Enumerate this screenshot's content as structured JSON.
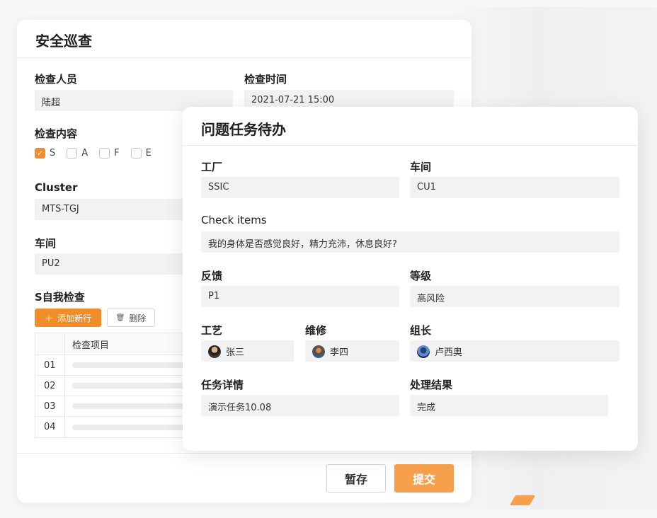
{
  "back_form": {
    "title": "安全巡查",
    "inspector_label": "检查人员",
    "inspector_value": "陆超",
    "time_label": "检查时间",
    "time_value": "2021-07-21 15:00",
    "content_label": "检查内容",
    "checkboxes": [
      {
        "label": "S",
        "checked": true
      },
      {
        "label": "A",
        "checked": false
      },
      {
        "label": "F",
        "checked": false
      },
      {
        "label": "E",
        "checked": false
      }
    ],
    "cluster_label": "Cluster",
    "cluster_value": "MTS-TGJ",
    "workshop_label": "车间",
    "workshop_value": "PU2",
    "self_check_label": "S自我检查",
    "add_row_label": "添加新行",
    "delete_label": "删除",
    "table": {
      "header_item": "检查项目",
      "rows": [
        "01",
        "02",
        "03",
        "04"
      ]
    },
    "save_label": "暂存",
    "submit_label": "提交"
  },
  "todo": {
    "title": "问题任务待办",
    "factory_label": "工厂",
    "factory_value": "SSIC",
    "workshop_label": "车间",
    "workshop_value": "CU1",
    "check_items_label": "Check items",
    "check_items_value": "我的身体是否感觉良好，精力充沛，休息良好?",
    "feedback_label": "反馈",
    "feedback_value": "P1",
    "level_label": "等级",
    "level_value": "高风险",
    "process_label": "工艺",
    "process_person": "张三",
    "maintenance_label": "维修",
    "maintenance_person": "李四",
    "leader_label": "组长",
    "leader_person": "卢西奥",
    "task_detail_label": "任务详情",
    "task_detail_value": "演示任务10.08",
    "result_label": "处理结果",
    "result_value": "完成"
  },
  "colors": {
    "accent": "#f28c28",
    "submit": "#f6a04d",
    "field_bg": "#f2f2f2"
  }
}
